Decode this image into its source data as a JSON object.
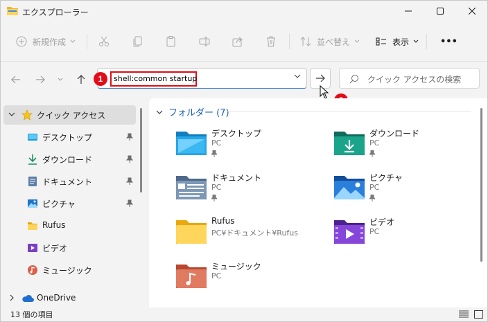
{
  "window": {
    "title": "エクスプローラー"
  },
  "toolbar": {
    "new_label": "新規作成",
    "sort_label": "並べ替え",
    "view_label": "表示",
    "more_label": "•••"
  },
  "navigation": {
    "address_value": "shell:common startup",
    "search_placeholder": "クイック アクセスの検索"
  },
  "badges": [
    "1",
    "2"
  ],
  "sidebar": {
    "items": [
      {
        "label": "クイック アクセス",
        "icon": "star-icon"
      },
      {
        "label": "デスクトップ",
        "icon": "desktop-icon"
      },
      {
        "label": "ダウンロード",
        "icon": "download-icon"
      },
      {
        "label": "ドキュメント",
        "icon": "document-icon"
      },
      {
        "label": "ピクチャ",
        "icon": "picture-icon"
      },
      {
        "label": "Rufus",
        "icon": "folder-icon"
      },
      {
        "label": "ビデオ",
        "icon": "video-icon"
      },
      {
        "label": "ミュージック",
        "icon": "music-icon"
      },
      {
        "label": "OneDrive",
        "icon": "cloud-icon"
      }
    ]
  },
  "content": {
    "group_title": "フォルダー (7)",
    "folders": [
      {
        "name": "デスクトップ",
        "location": "PC",
        "icon": "desktop-folder-icon"
      },
      {
        "name": "ダウンロード",
        "location": "PC",
        "icon": "download-folder-icon"
      },
      {
        "name": "ドキュメント",
        "location": "PC",
        "icon": "document-folder-icon"
      },
      {
        "name": "ピクチャ",
        "location": "PC",
        "icon": "picture-folder-icon"
      },
      {
        "name": "Rufus",
        "location": "PC¥ドキュメント¥Rufus",
        "icon": "folder-icon"
      },
      {
        "name": "ビデオ",
        "location": "PC",
        "icon": "video-folder-icon"
      },
      {
        "name": "ミュージック",
        "location": "PC",
        "icon": "music-folder-icon"
      }
    ]
  },
  "status": {
    "item_count": "13 個の項目"
  },
  "colors": {
    "accent": "#1a5fb4",
    "highlight_red": "#e30b17"
  }
}
